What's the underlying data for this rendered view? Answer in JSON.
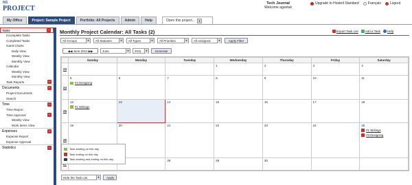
{
  "logo": {
    "line1": "MS",
    "line2": "PROJECT"
  },
  "user": {
    "name": "Tech Journal",
    "welcome": "Welcome aguntuk"
  },
  "toplinks": [
    {
      "label": "Upgrade to Hosted Standard",
      "on": true
    },
    {
      "label": "Français",
      "on": false
    },
    {
      "label": "Logout",
      "on": false
    }
  ],
  "tabs": [
    {
      "label": "My Office",
      "active": false
    },
    {
      "label": "Project: Sample Project",
      "active": true
    },
    {
      "label": "Portfolio: All Projects",
      "active": false
    },
    {
      "label": "Admin",
      "active": false
    },
    {
      "label": "Help",
      "active": false
    }
  ],
  "open_project": "Open this project...",
  "sidebar": [
    {
      "type": "head",
      "label": "Tasks",
      "selected": true
    },
    {
      "type": "item",
      "label": "Incomplete Tasks"
    },
    {
      "type": "item",
      "label": "Completed Tasks"
    },
    {
      "type": "item",
      "label": "Gantt Charts"
    },
    {
      "type": "sub",
      "label": "Daily View"
    },
    {
      "type": "sub",
      "label": "Weekly View"
    },
    {
      "type": "sub",
      "label": "Monthly View"
    },
    {
      "type": "item",
      "label": "Calendar"
    },
    {
      "type": "sub",
      "label": "Weekly View"
    },
    {
      "type": "sub",
      "label": "Monthly View"
    },
    {
      "type": "item",
      "label": "Task Reports",
      "minus": true
    },
    {
      "type": "head",
      "label": "Documents"
    },
    {
      "type": "item",
      "label": "Project Documents"
    },
    {
      "type": "item",
      "label": "Search"
    },
    {
      "type": "head",
      "label": "Time"
    },
    {
      "type": "item",
      "label": "Time Report"
    },
    {
      "type": "item",
      "label": "Time Approval",
      "minus": true
    },
    {
      "type": "sub",
      "label": "Weekly View"
    },
    {
      "type": "sub",
      "label": "Work Items View"
    },
    {
      "type": "head",
      "label": "Expenses"
    },
    {
      "type": "item",
      "label": "Expense Report"
    },
    {
      "type": "item",
      "label": "Expense Approval"
    },
    {
      "type": "head",
      "label": "Statistics"
    }
  ],
  "page_title": "Monthly Project Calendar: All Tasks (2)",
  "right_links": [
    "Export Task List",
    "Add a Task",
    "Help"
  ],
  "filters": {
    "groups": "All Groups",
    "statuses": "All Statuses",
    "types": "All Types",
    "priorities": "All Priorities",
    "assigned": "All Assigned",
    "apply": "Apply Filter"
  },
  "nav": {
    "prev_next": "◀◀ June 2011 ▶▶",
    "month": "June",
    "year": "2011",
    "generate": "Generate"
  },
  "weekdays": [
    "Sunday",
    "Monday",
    "Tuesday",
    "Wednesday",
    "Thursday",
    "Friday",
    "Saturday"
  ],
  "weeks": [
    {
      "num": "23",
      "days": [
        "",
        "",
        "",
        "1",
        "2",
        "3",
        "4"
      ]
    },
    {
      "num": "24",
      "days": [
        "5",
        "6",
        "7",
        "8",
        "9",
        "10",
        "11"
      ]
    },
    {
      "num": "25",
      "days": [
        "12",
        "13",
        "14",
        "15",
        "16",
        "17",
        "18"
      ]
    },
    {
      "num": "26",
      "days": [
        "19",
        "20",
        "21",
        "22",
        "23",
        "24",
        "25"
      ]
    },
    {
      "num": "27",
      "days": [
        "26",
        "27",
        "28",
        "29",
        "30",
        "",
        ""
      ]
    }
  ],
  "events": [
    {
      "week": 1,
      "day": 0,
      "label": "#3 Designing",
      "color": "#8cbf3f"
    },
    {
      "week": 2,
      "day": 0,
      "label": "#1 Writings",
      "color": "#8cbf3f"
    },
    {
      "week": 3,
      "day": 6,
      "label": "#1 Writings",
      "color": "#c83030"
    },
    {
      "week": 3,
      "day": 6,
      "label": "#3 Designing",
      "color": "#c83030"
    }
  ],
  "today": {
    "week": 2,
    "day": 1
  },
  "legend": [
    {
      "label": "Task starting on this day.",
      "color": "#8cbf3f"
    },
    {
      "label": "Task ending on this day.",
      "color": "#c83030"
    },
    {
      "label": "Task starting and ending on this day.",
      "color": "#3a3a3a"
    }
  ],
  "hide": {
    "select": "Hide the Task List",
    "apply": "Apply"
  }
}
